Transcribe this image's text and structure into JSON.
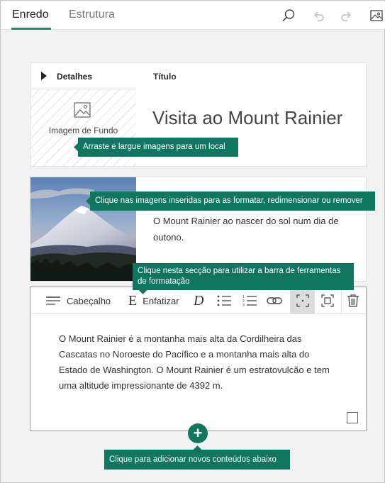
{
  "tabs": {
    "story": "Enredo",
    "structure": "Estrutura"
  },
  "toolbar_icons": [
    "search-icon",
    "undo-icon",
    "redo-icon",
    "image-icon"
  ],
  "details": {
    "label": "Detalhes",
    "background_label": "Imagem de Fundo"
  },
  "title_block": {
    "label": "Título",
    "text": "Visita ao Mount Rainier"
  },
  "image_card": {
    "caption": "O Mount Rainier ao nascer do sol num dia de outono."
  },
  "format_bar": {
    "heading": "Cabeçalho",
    "emphasize": "Enfatizar"
  },
  "text_block": {
    "body": "O Mount Rainier é a montanha mais alta da Cordilheira das Cascatas no Noroeste do Pacífico e a montanha mais alta do Estado de Washington. O Mount Rainier é um estratovulcão e tem uma altitude impressionante de 4392 m."
  },
  "tooltips": {
    "drag_images": "Arraste e largue imagens para um local",
    "click_images": "Clique nas imagens inseridas para as formatar, redimensionar ou remover",
    "format_section": "Clique nesta secção para utilizar a barra de ferramentas de formatação",
    "add_content": "Clique para adicionar novos conteúdos abaixo"
  },
  "add_button_symbol": "+",
  "colors": {
    "accent": "#10765f",
    "tab_underline": "#1f8a70"
  }
}
